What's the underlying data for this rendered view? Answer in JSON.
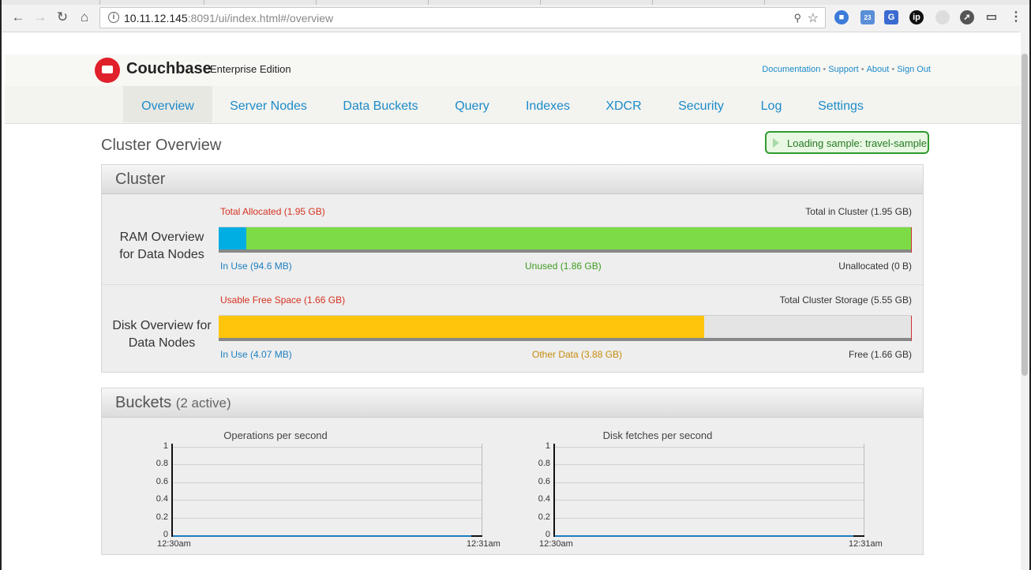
{
  "browser": {
    "url_host": "10.11.12.145",
    "url_rest": ":8091/ui/index.html#/overview",
    "ext_badge": "23"
  },
  "header": {
    "brand": "Couchbase",
    "edition": "Enterprise Edition",
    "links": [
      "Documentation",
      "Support",
      "About",
      "Sign Out"
    ]
  },
  "nav": {
    "tabs": [
      "Overview",
      "Server Nodes",
      "Data Buckets",
      "Query",
      "Indexes",
      "XDCR",
      "Security",
      "Log",
      "Settings"
    ],
    "active": "Overview"
  },
  "page": {
    "title": "Cluster Overview",
    "loading": "Loading sample: travel-sample"
  },
  "cluster": {
    "title": "Cluster",
    "ram": {
      "label_line1": "RAM Overview",
      "label_line2": "for Data Nodes",
      "total_allocated": "Total Allocated (1.95 GB)",
      "total_in_cluster": "Total in Cluster (1.95 GB)",
      "in_use": "In Use (94.6 MB)",
      "unused": "Unused (1.86 GB)",
      "unallocated": "Unallocated (0 B)",
      "in_use_fraction": 0.04,
      "unused_fraction": 0.96,
      "colors": {
        "in_use": "#00aee3",
        "unused": "#7ddc45"
      }
    },
    "disk": {
      "label_line1": "Disk Overview for",
      "label_line2": "Data Nodes",
      "usable_free": "Usable Free Space (1.66 GB)",
      "total_storage": "Total Cluster Storage (5.55 GB)",
      "in_use": "In Use (4.07 MB)",
      "other_data": "Other Data (3.88 GB)",
      "free": "Free (1.66 GB)",
      "other_fraction": 0.7,
      "free_fraction": 0.3,
      "colors": {
        "other": "#fec50c",
        "free": "#e4e4e4"
      }
    }
  },
  "buckets": {
    "title": "Buckets",
    "subtitle": "(2 active)",
    "charts": [
      {
        "title": "Operations per second",
        "y_ticks": [
          "1",
          "0.8",
          "0.6",
          "0.4",
          "0.2",
          "0"
        ],
        "x_ticks": [
          "12:30am",
          "12:31am"
        ]
      },
      {
        "title": "Disk fetches per second",
        "y_ticks": [
          "1",
          "0.8",
          "0.6",
          "0.4",
          "0.2",
          "0"
        ],
        "x_ticks": [
          "12:30am",
          "12:31am"
        ]
      }
    ]
  }
}
